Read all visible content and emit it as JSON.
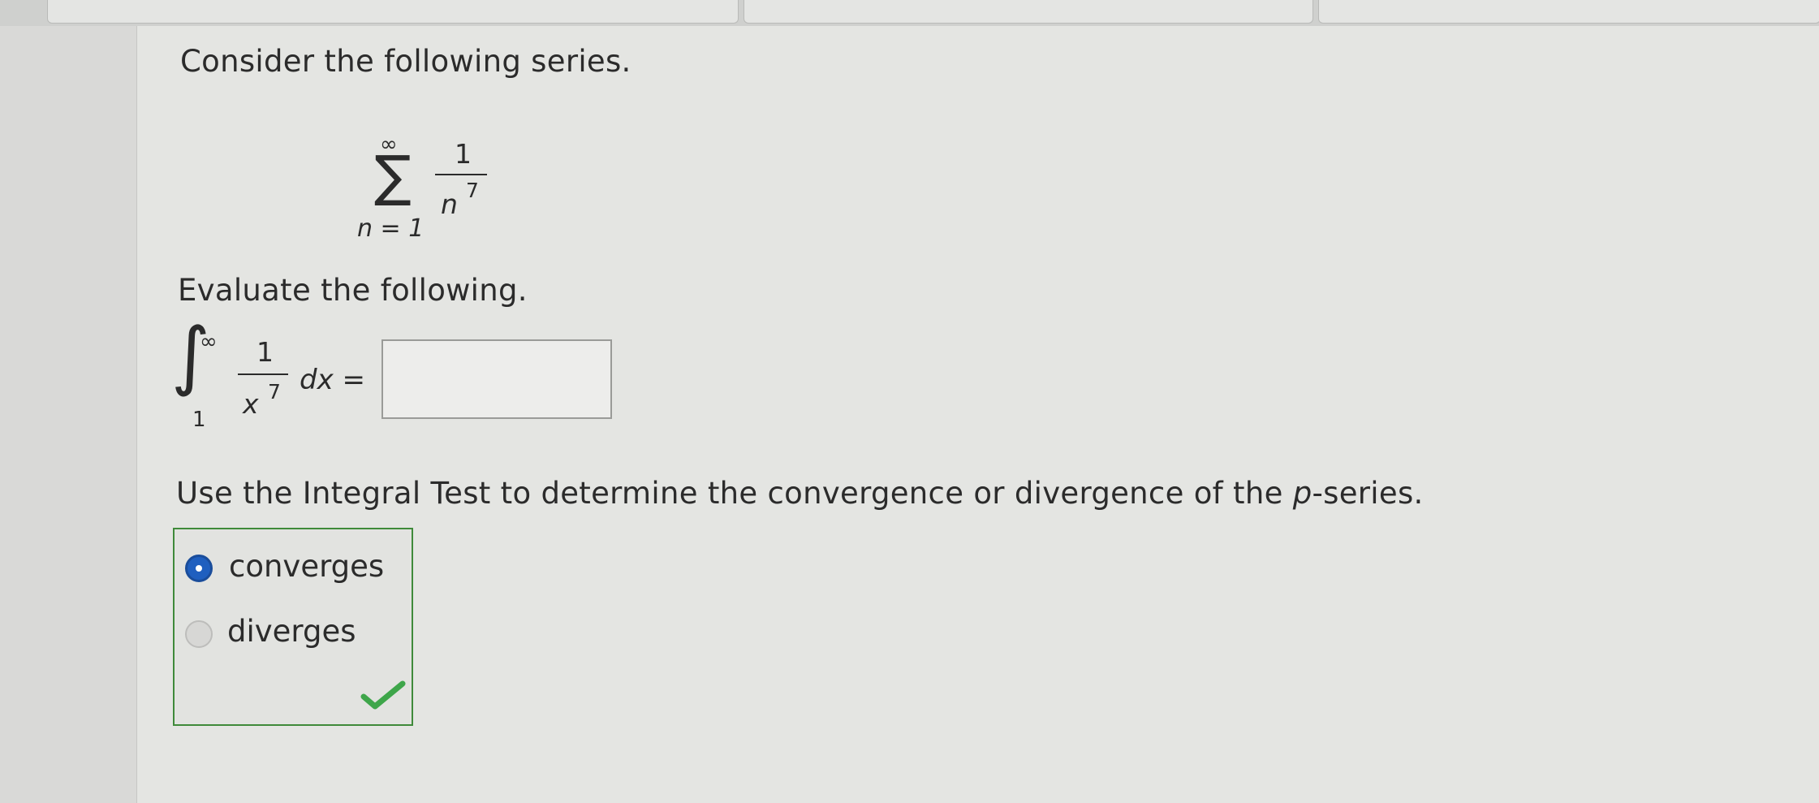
{
  "question": {
    "intro": "Consider the following series.",
    "series": {
      "sum_symbol": "∑",
      "upper_limit": "∞",
      "lower_limit": "n = 1",
      "numerator": "1",
      "denominator_base": "n",
      "denominator_exponent": "7"
    },
    "evaluate_prompt": "Evaluate the following.",
    "integral": {
      "integral_symbol": "∫",
      "upper_limit": "∞",
      "lower_limit": "1",
      "numerator": "1",
      "denominator_base": "x",
      "denominator_exponent": "7",
      "differential": "dx =",
      "answer_value": "",
      "answer_placeholder": ""
    },
    "integral_test_prompt_prefix": "Use the Integral Test to determine the convergence or divergence of the ",
    "integral_test_prompt_p": "p",
    "integral_test_prompt_suffix": "-series.",
    "choices": [
      {
        "label": "converges",
        "selected": true
      },
      {
        "label": "diverges",
        "selected": false
      }
    ],
    "correct_mark": "✔"
  },
  "colors": {
    "selected_radio": "#1f5fbf",
    "correct_border": "#3f8a3a",
    "check_mark": "#3ea64a"
  }
}
